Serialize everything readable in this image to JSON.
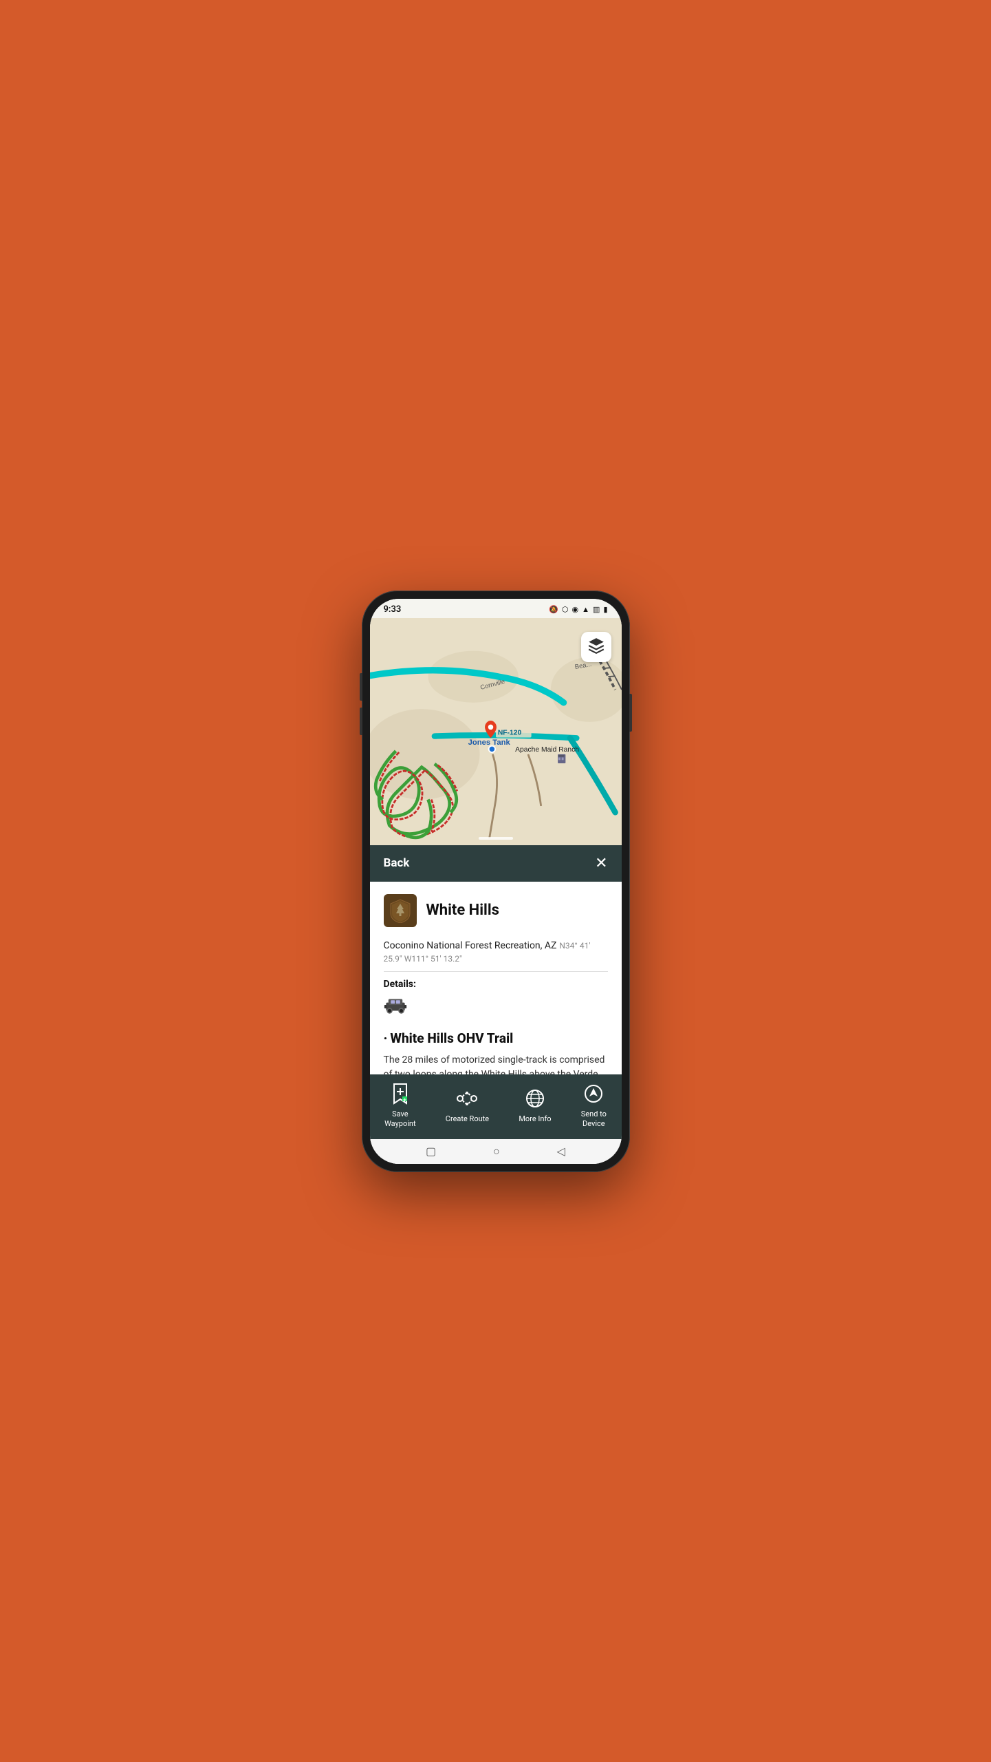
{
  "phone": {
    "status_bar": {
      "time": "9:33",
      "icons": [
        "signal",
        "bluetooth",
        "location",
        "wifi",
        "no-signal-1",
        "no-signal-2",
        "battery"
      ]
    }
  },
  "map": {
    "labels": {
      "nf_road": "NF-120",
      "cornville": "Cornville",
      "bear": "Bea...",
      "ranch": "Apache Maid Ranch",
      "jones_tank": "Jones Tank"
    },
    "layer_button_icon": "layers-icon"
  },
  "sheet": {
    "back_label": "Back",
    "close_label": "✕",
    "place": {
      "name": "White Hills",
      "organization": "Coconino National Forest Recreation, AZ",
      "coordinates": "N34° 41' 25.9\" W111° 51' 13.2\"",
      "details_label": "Details:",
      "trail_title": "White Hills OHV Trail",
      "trail_description": "The 28 miles of motorized single-track is comprised of two loops along the White Hills above the Verde River."
    },
    "actions": [
      {
        "id": "save-waypoint",
        "label": "Save\nWaypoint",
        "icon": "bookmark-plus-icon"
      },
      {
        "id": "create-route",
        "label": "Create Route",
        "icon": "route-icon"
      },
      {
        "id": "more-info",
        "label": "More Info",
        "icon": "globe-icon"
      },
      {
        "id": "send-to-device",
        "label": "Send to\nDevice",
        "icon": "navigation-icon"
      }
    ]
  },
  "android_nav": {
    "back_icon": "triangle-back",
    "home_icon": "circle-home",
    "recents_icon": "square-recents"
  }
}
